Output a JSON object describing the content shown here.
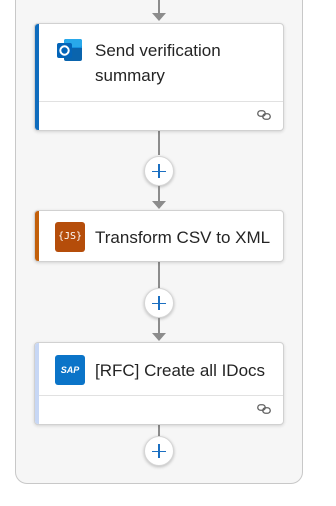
{
  "flow": {
    "steps": [
      {
        "title": "Send verification summary",
        "icon": "outlook-icon",
        "accent_color": "#0f6cbd",
        "has_connection_footer": true
      },
      {
        "title": "Transform CSV to XML",
        "icon": "javascript-icon",
        "icon_text": "{JS}",
        "accent_color": "#c25f0a",
        "has_connection_footer": false
      },
      {
        "title": "[RFC] Create all IDocs",
        "icon": "sap-icon",
        "icon_text": "SAP",
        "accent_color": "#c7d7f5",
        "has_connection_footer": true
      }
    ],
    "add_button_symbol": "+",
    "connection_icon": "link-icon"
  }
}
